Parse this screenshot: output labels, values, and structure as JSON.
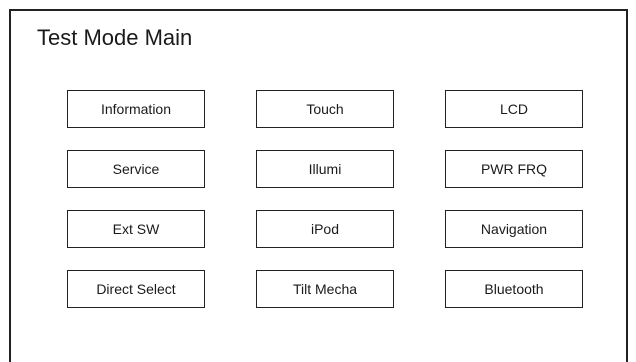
{
  "screen": {
    "title": "Test Mode Main"
  },
  "menu": {
    "buttons": [
      {
        "label": "Information"
      },
      {
        "label": "Touch"
      },
      {
        "label": "LCD"
      },
      {
        "label": "Service"
      },
      {
        "label": "Illumi"
      },
      {
        "label": "PWR FRQ"
      },
      {
        "label": "Ext SW"
      },
      {
        "label": "iPod"
      },
      {
        "label": "Navigation"
      },
      {
        "label": "Direct Select"
      },
      {
        "label": "Tilt Mecha"
      },
      {
        "label": "Bluetooth"
      }
    ]
  }
}
